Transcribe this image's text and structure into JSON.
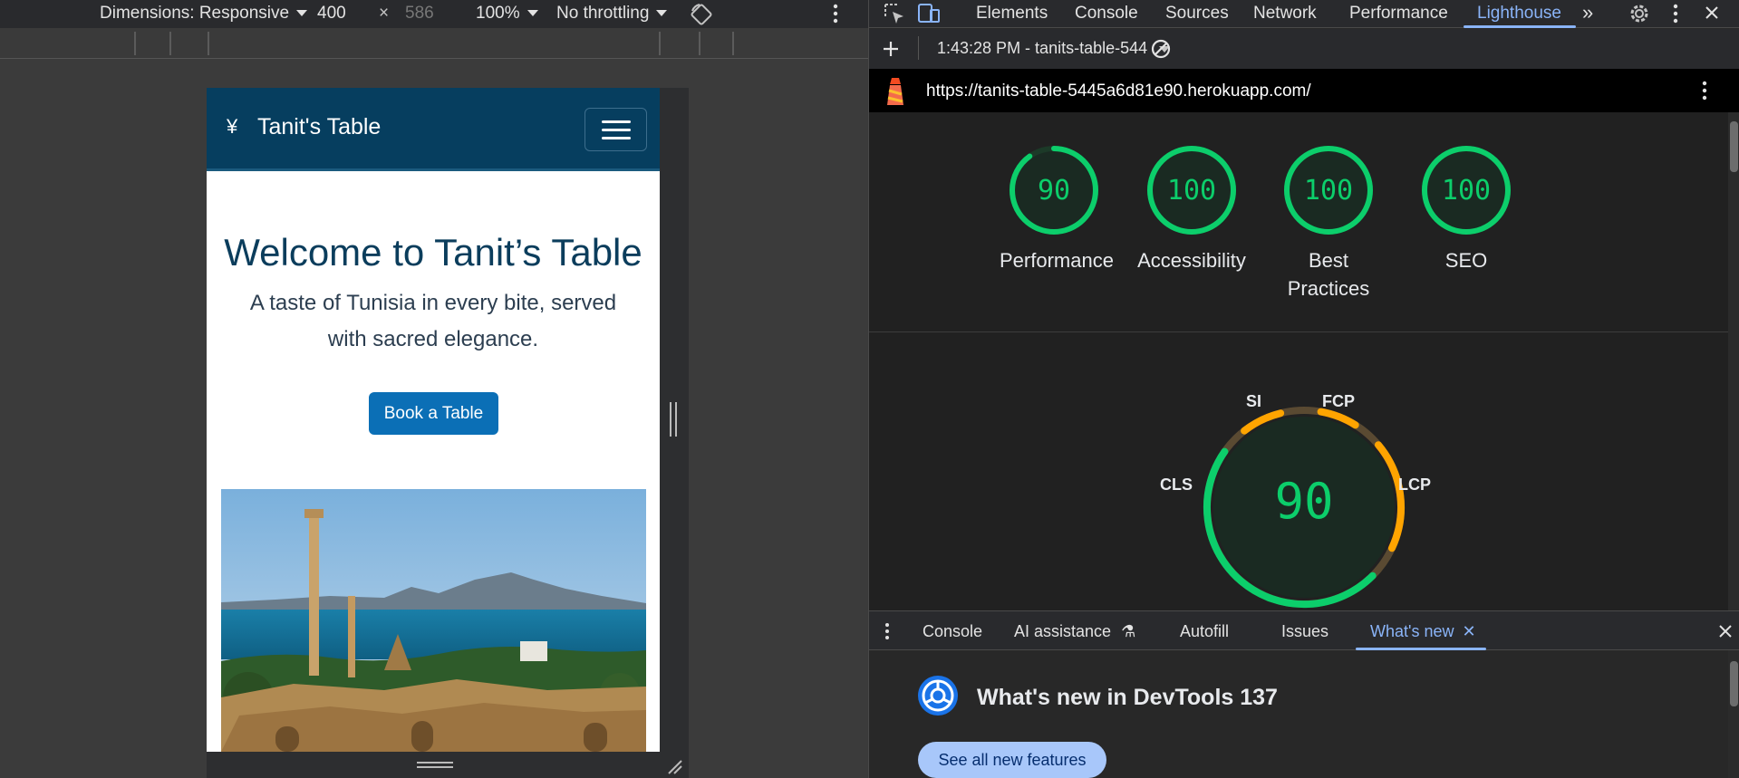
{
  "emulation": {
    "dimensions_label": "Dimensions: Responsive",
    "width_value": "400",
    "times": "×",
    "height_value": "586",
    "zoom": "100%",
    "throttling": "No throttling"
  },
  "device_page": {
    "brand_icon": "¥",
    "brand": "Tanit's Table",
    "hero_title": "Welcome to Tanit’s Table",
    "hero_subtitle": "A taste of Tunisia in every bite, served with sacred elegance.",
    "book_button": "Book a Table"
  },
  "devtools": {
    "tabs": [
      "Elements",
      "Console",
      "Sources",
      "Network",
      "Performance",
      "Lighthouse"
    ],
    "active_tab": "Lighthouse",
    "lighthouse_bar": {
      "report_time": "1:43:28 PM - tanits-table-544"
    },
    "url": "https://tanits-table-5445a6d81e90.herokuapp.com/",
    "scores": [
      {
        "label": "Performance",
        "value": 90
      },
      {
        "label": "Accessibility",
        "value": 100
      },
      {
        "label": "Best Practices",
        "value": 100
      },
      {
        "label": "SEO",
        "value": 100
      }
    ],
    "perf_gauge": {
      "value": "90",
      "metrics": [
        "SI",
        "FCP",
        "CLS",
        "LCP"
      ]
    },
    "drawer_tabs": [
      "Console",
      "AI assistance",
      "Autofill",
      "Issues",
      "What's new"
    ],
    "active_drawer_tab": "What's new",
    "whats_new": {
      "title": "What's new in DevTools 137",
      "button": "See all new features"
    },
    "colors": {
      "pass": "#0cce6b",
      "average": "#ffa400",
      "accent": "#8ab4f8"
    }
  }
}
